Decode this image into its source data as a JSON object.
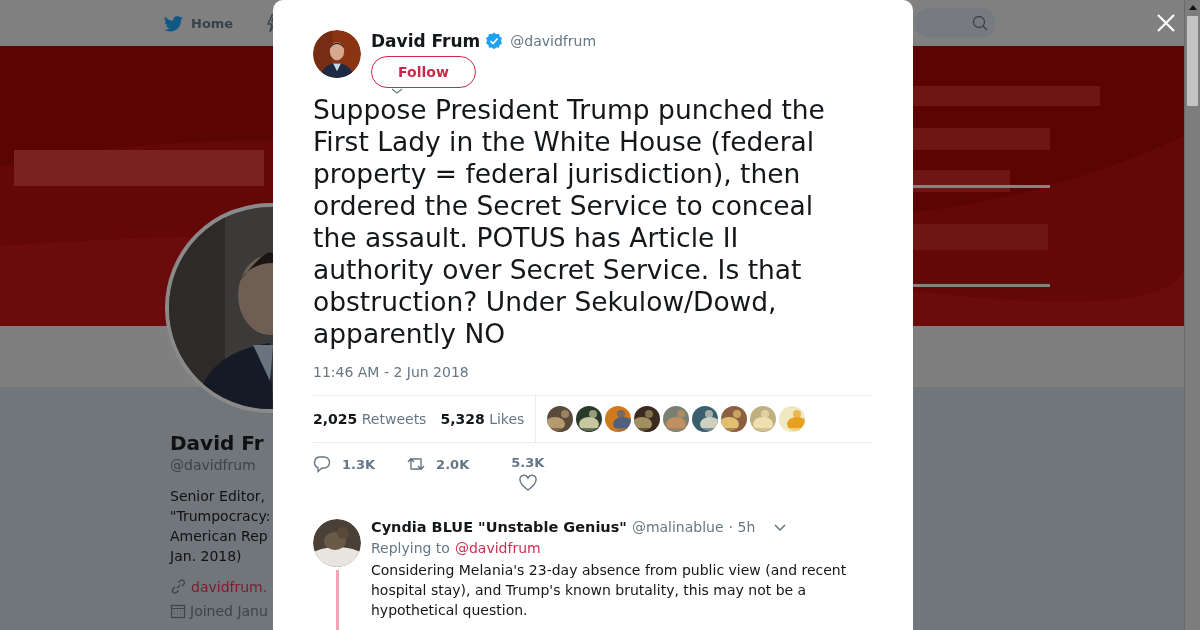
{
  "nav": {
    "home_label": "Home"
  },
  "profile": {
    "name": "David Fr",
    "handle": "@davidfrum",
    "bio_lines": [
      "Senior Editor,",
      "\"Trumpocracy:",
      "American Rep",
      "Jan. 2018)"
    ],
    "website": "davidfrum.",
    "joined": "Joined Janu"
  },
  "tweet": {
    "author": {
      "name": "David Frum",
      "verified": true,
      "handle": "@davidfrum"
    },
    "follow_button": "Follow",
    "text": "Suppose President Trump punched the First Lady in the White House (federal property = federal jurisdiction), then ordered the Secret Service to conceal the assault. POTUS has Article II authority over Secret Service. Is that obstruction? Under Sekulow/Dowd, apparently NO",
    "timestamp": "11:46 AM - 2 Jun 2018",
    "stats": [
      {
        "count": "2,025",
        "label": "Retweets"
      },
      {
        "count": "5,328",
        "label": "Likes"
      }
    ],
    "actions": [
      {
        "kind": "reply",
        "count": "1.3K"
      },
      {
        "kind": "retweet",
        "count": "2.0K"
      },
      {
        "kind": "like",
        "count": "5.3K"
      }
    ]
  },
  "replies": [
    {
      "name": "Cyndia BLUE \"Unstable Genius\"",
      "handle": "@malinablue",
      "time": "· 5h",
      "replying_label": "Replying to",
      "replying_to": "@davidfrum",
      "text": "Considering Melania's 23-day absence from public view (and recent hospital stay), and Trump's known brutality, this may not be a hypothetical question."
    }
  ]
}
